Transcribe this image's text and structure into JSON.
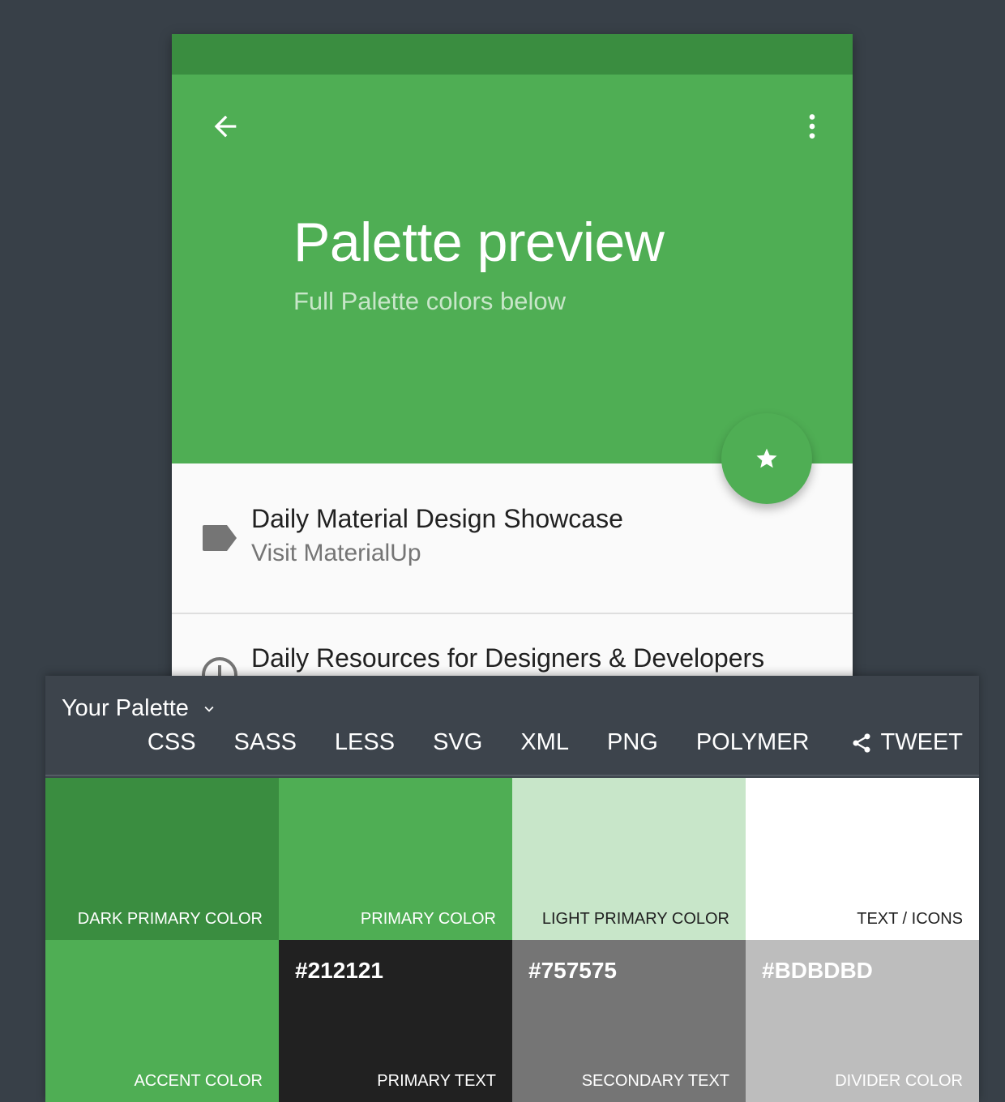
{
  "colors": {
    "dark_primary": "#3a8d40",
    "primary": "#4fae54",
    "light_primary": "#c8e6c9",
    "text_icons": "#ffffff",
    "accent": "#4fae54",
    "primary_text": "#212121",
    "secondary_text": "#757575",
    "divider": "#bdbdbd",
    "page_background": "#384048",
    "panel_background": "#3d444c"
  },
  "preview": {
    "back_icon": "arrow-left-icon",
    "more_icon": "more-vertical-icon",
    "title": "Palette preview",
    "subtitle": "Full Palette colors below",
    "fab_icon": "star-icon",
    "list": [
      {
        "icon": "label-tag-icon",
        "primary": "Daily Material Design Showcase",
        "secondary": "Visit MaterialUp"
      },
      {
        "icon": "info-circle-icon",
        "primary": "Daily Resources for Designers & Developers",
        "secondary": ""
      }
    ]
  },
  "panel": {
    "palette_label": "Your Palette",
    "dropdown_icon": "chevron-down-icon",
    "export_tabs": [
      "CSS",
      "SASS",
      "LESS",
      "SVG",
      "XML",
      "PNG",
      "POLYMER"
    ],
    "tweet_label": "TWEET",
    "tweet_icon": "share-icon"
  },
  "swatches": [
    {
      "name": "DARK PRIMARY COLOR",
      "hex": "",
      "bg": "#3a8d40",
      "fg": "#ffffff"
    },
    {
      "name": "PRIMARY COLOR",
      "hex": "",
      "bg": "#4fae54",
      "fg": "#ffffff"
    },
    {
      "name": "LIGHT PRIMARY COLOR",
      "hex": "",
      "bg": "#c8e6c9",
      "fg": "#212121"
    },
    {
      "name": "TEXT / ICONS",
      "hex": "",
      "bg": "#ffffff",
      "fg": "#212121"
    },
    {
      "name": "ACCENT COLOR",
      "hex": "",
      "bg": "#4fae54",
      "fg": "#ffffff"
    },
    {
      "name": "PRIMARY TEXT",
      "hex": "#212121",
      "bg": "#212121",
      "fg": "#ffffff"
    },
    {
      "name": "SECONDARY TEXT",
      "hex": "#757575",
      "bg": "#757575",
      "fg": "#ffffff"
    },
    {
      "name": "DIVIDER COLOR",
      "hex": "#BDBDBD",
      "bg": "#bdbdbd",
      "fg": "#ffffff"
    }
  ]
}
